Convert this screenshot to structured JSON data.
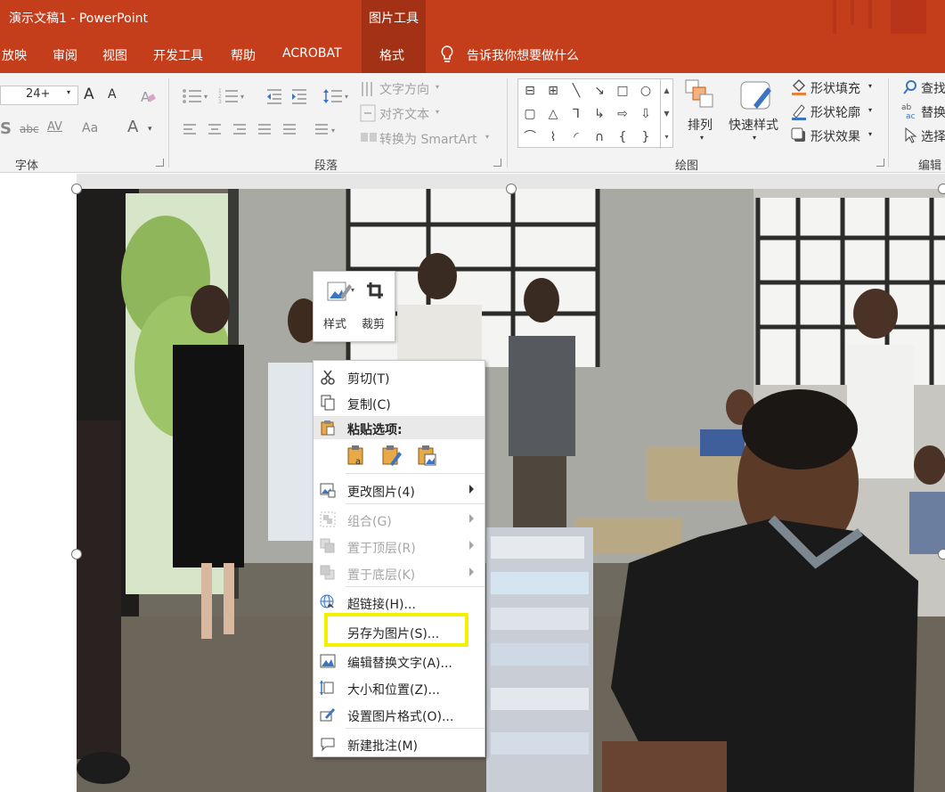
{
  "titlebar": {
    "title": "演示文稿1  -  PowerPoint",
    "context_tab_group": "图片工具"
  },
  "tabs": {
    "slideshow": "放映",
    "review": "审阅",
    "view": "视图",
    "developer": "开发工具",
    "help": "帮助",
    "acrobat": "ACROBAT",
    "format": "格式",
    "tell_me": "告诉我你想要做什么"
  },
  "ribbon": {
    "font": {
      "size_value": "24+",
      "grow_font": "A",
      "shrink_font": "A",
      "char_spacing": "AV",
      "change_case": "Aa",
      "font_color": "A",
      "group_label": "字体"
    },
    "paragraph": {
      "text_direction": "文字方向",
      "align_text": "对齐文本",
      "convert_smartart": "转换为 SmartArt",
      "group_label": "段落"
    },
    "drawing": {
      "arrange": "排列",
      "quick_styles": "快速样式",
      "shape_fill": "形状填充",
      "shape_outline": "形状轮廓",
      "shape_effects": "形状效果",
      "group_label": "绘图",
      "shape_glyphs": [
        "⊟",
        "⊞",
        "╲",
        "↘",
        "□",
        "○",
        "▢",
        "△",
        "⅂",
        "↳",
        "⇨",
        "⇩",
        "⌒",
        "⌇",
        "◜",
        "∩",
        "{",
        "}"
      ]
    },
    "editing": {
      "find": "查找",
      "replace": "替换",
      "select": "选择",
      "group_label": "编辑"
    }
  },
  "mini_toolbar": {
    "style": "样式",
    "crop": "裁剪"
  },
  "context_menu": {
    "cut": "剪切(T)",
    "copy": "复制(C)",
    "paste_options": "粘贴选项:",
    "change_picture": "更改图片(4)",
    "group": "组合(G)",
    "bring_to_front": "置于顶层(R)",
    "send_to_back": "置于底层(K)",
    "hyperlink": "超链接(H)...",
    "save_as_picture": "另存为图片(S)...",
    "edit_alt_text": "编辑替换文字(A)...",
    "size_and_position": "大小和位置(Z)...",
    "format_picture": "设置图片格式(O)...",
    "new_comment": "新建批注(M)"
  },
  "colors": {
    "accent": "#c43e1c",
    "accent_dark": "#a33115",
    "highlight": "#f5ef00",
    "ribbon_bg": "#f3f3f3"
  }
}
